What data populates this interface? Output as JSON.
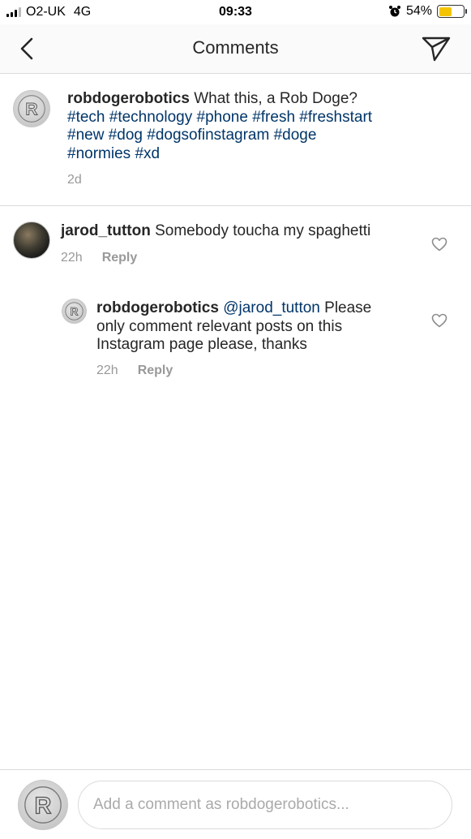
{
  "status_bar": {
    "carrier": "O2-UK",
    "network": "4G",
    "time": "09:33",
    "battery_percent": "54%",
    "battery_level": 0.54,
    "battery_color": "#f5c400"
  },
  "nav": {
    "title": "Comments",
    "back_icon": "chevron-left-icon",
    "send_icon": "paper-plane-icon"
  },
  "caption": {
    "username": "robdogerobotics",
    "text": "What this, a Rob Doge?",
    "hashtags": [
      "#tech",
      "#technology",
      "#phone",
      "#fresh",
      "#freshstart",
      "#new",
      "#dog",
      "#dogsofinstagram",
      "#doge",
      "#normies",
      "#xd"
    ],
    "time": "2d"
  },
  "comments": [
    {
      "username": "jarod_tutton",
      "text": "Somebody toucha my spaghetti",
      "time": "22h",
      "reply_label": "Reply"
    }
  ],
  "replies": [
    {
      "username": "robdogerobotics",
      "mention": "@jarod_tutton",
      "text_line1": "Please",
      "text_line2": "only comment relevant posts on this",
      "text_line3": "Instagram page please, thanks",
      "time": "22h",
      "reply_label": "Reply"
    }
  ],
  "composer": {
    "placeholder": "Add a comment as robdogerobotics..."
  },
  "colors": {
    "hashtag": "#003569",
    "meta": "#999999",
    "divider": "#dbdbdb"
  }
}
